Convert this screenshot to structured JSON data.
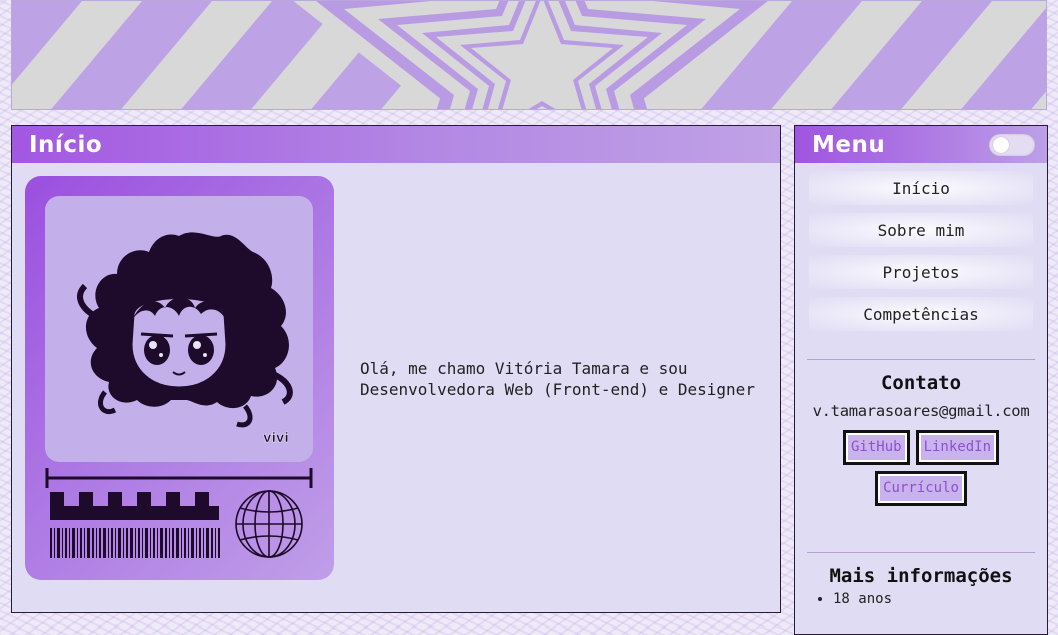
{
  "main": {
    "title": "Início",
    "card_signature": "vivi",
    "intro_text": "Olá, me chamo Vitória Tamara e sou Desenvolvedora Web (Front-end) e Designer"
  },
  "sidebar": {
    "title": "Menu",
    "theme_toggle": "off",
    "nav": [
      {
        "label": "Início"
      },
      {
        "label": "Sobre mim"
      },
      {
        "label": "Projetos"
      },
      {
        "label": "Competências"
      }
    ],
    "contact": {
      "title": "Contato",
      "email": "v.tamarasoares@gmail.com",
      "buttons": [
        {
          "label": "GitHub"
        },
        {
          "label": "LinkedIn"
        },
        {
          "label": "Currículo"
        }
      ]
    },
    "more_info": {
      "title": "Mais informações",
      "items": [
        "18 anos"
      ]
    }
  },
  "colors": {
    "accent_purple": "#a357e2",
    "panel_background": "#e0dcf4",
    "button_text": "#8f4fd0"
  },
  "icons": [
    "star-banner",
    "toggle-switch",
    "globe-icon",
    "barcode-icon",
    "checker-pattern"
  ]
}
